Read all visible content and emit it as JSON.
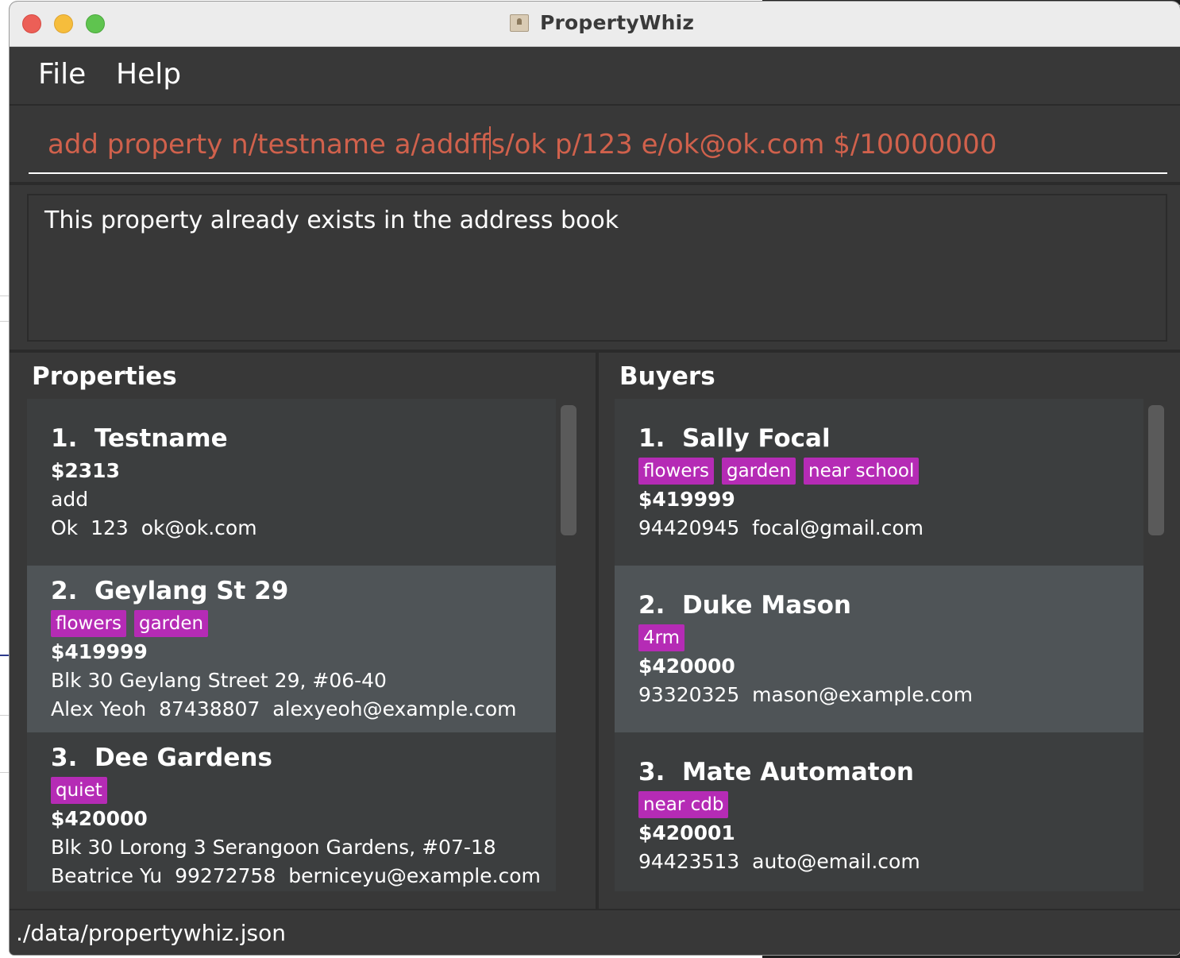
{
  "window": {
    "title": "PropertyWhiz"
  },
  "menu": {
    "file": "File",
    "help": "Help"
  },
  "command": {
    "before_cursor": "add property n/testname a/addff",
    "after_cursor": "s/ok p/123 e/ok@ok.com $/10000000"
  },
  "result": {
    "message": "This property already exists in the address book"
  },
  "properties": {
    "title": "Properties",
    "items": [
      {
        "index": "1.",
        "name": "Testname",
        "tags": [],
        "price": "$2313",
        "address": "add",
        "owner": "Ok",
        "phone": "123",
        "email": "ok@ok.com"
      },
      {
        "index": "2.",
        "name": "Geylang St 29",
        "tags": [
          "flowers",
          "garden"
        ],
        "price": "$419999",
        "address": "Blk 30 Geylang Street 29, #06-40",
        "owner": "Alex Yeoh",
        "phone": "87438807",
        "email": "alexyeoh@example.com"
      },
      {
        "index": "3.",
        "name": "Dee Gardens",
        "tags": [
          "quiet"
        ],
        "price": "$420000",
        "address": "Blk 30 Lorong 3 Serangoon Gardens, #07-18",
        "owner": "Beatrice Yu",
        "phone": "99272758",
        "email": "berniceyu@example.com"
      }
    ]
  },
  "buyers": {
    "title": "Buyers",
    "items": [
      {
        "index": "1.",
        "name": "Sally Focal",
        "tags": [
          "flowers",
          "garden",
          "near school"
        ],
        "budget": "$419999",
        "phone": "94420945",
        "email": "focal@gmail.com"
      },
      {
        "index": "2.",
        "name": "Duke Mason",
        "tags": [
          "4rm"
        ],
        "budget": "$420000",
        "phone": "93320325",
        "email": "mason@example.com"
      },
      {
        "index": "3.",
        "name": "Mate Automaton",
        "tags": [
          "near cdb"
        ],
        "budget": "$420001",
        "phone": "94423513",
        "email": "auto@email.com"
      }
    ]
  },
  "status": {
    "file_path": "./data/propertywhiz.json"
  },
  "colors": {
    "tag": "#b52bb5",
    "command_text": "#d0614c",
    "background": "#383838",
    "selected_card": "#4f5457"
  }
}
